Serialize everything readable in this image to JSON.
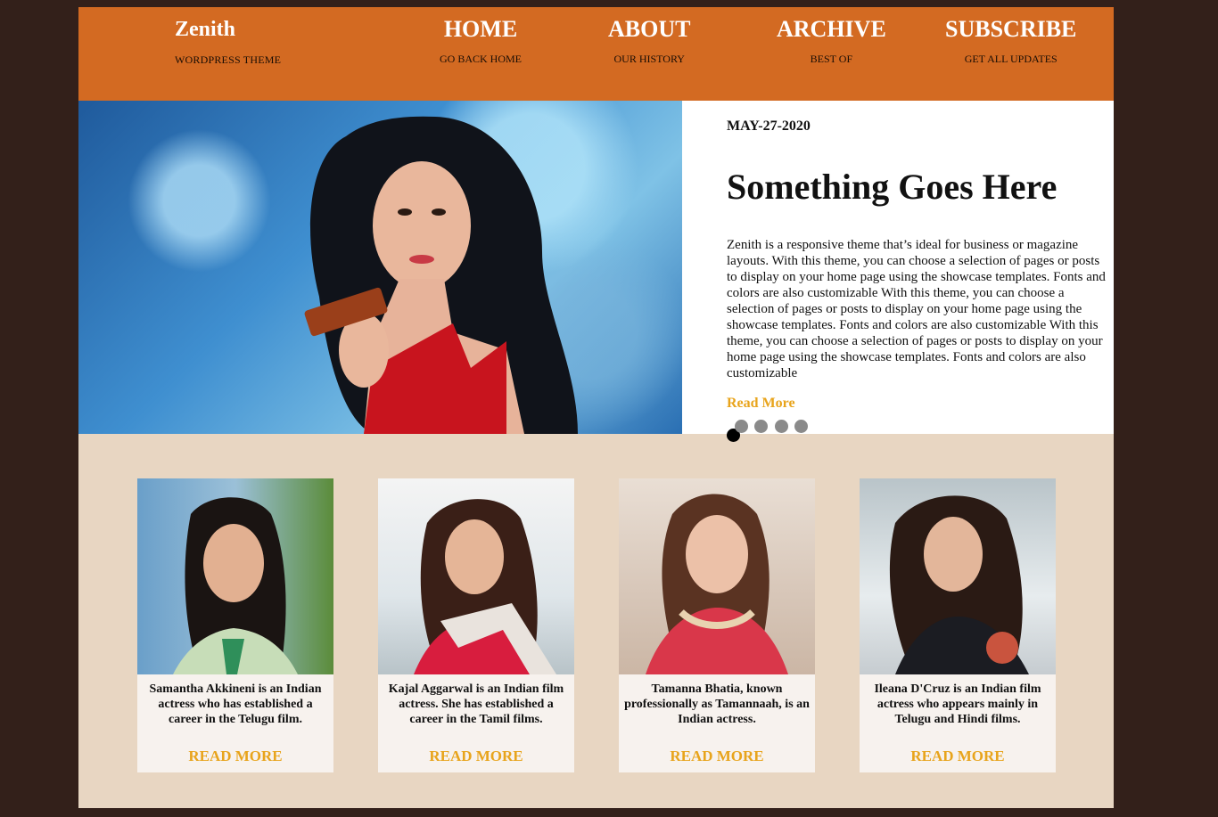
{
  "brand": {
    "name": "Zenith",
    "tagline": "WORDPRESS THEME"
  },
  "nav": [
    {
      "label": "HOME",
      "sub": "GO BACK HOME"
    },
    {
      "label": "ABOUT",
      "sub": "OUR HISTORY"
    },
    {
      "label": "ARCHIVE",
      "sub": "BEST OF"
    },
    {
      "label": "SUBSCRIBE",
      "sub": "GET ALL UPDATES"
    }
  ],
  "hero": {
    "date": "MAY-27-2020",
    "title": "Something Goes Here",
    "body": "Zenith is a responsive theme that’s ideal for business or magazine layouts. With this theme, you can choose a selection of pages or posts to display on your home page using the showcase templates. Fonts and colors are also customizable With this theme, you can choose a selection of pages or posts to display on your home page using the showcase templates. Fonts and colors are also customizable With this theme, you can choose a selection of pages or posts to display on your home page using the showcase templates. Fonts and colors are also customizable",
    "read_more": "Read More",
    "slide_count": 5,
    "active_slide": 1
  },
  "cards": [
    {
      "text": "Samantha Akkineni is an Indian actress who has established a career in the Telugu film.",
      "read_more": "READ MORE"
    },
    {
      "text": "Kajal Aggarwal is an Indian film actress. She has established a career in the Tamil films.",
      "read_more": "READ MORE"
    },
    {
      "text": "Tamanna Bhatia, known professionally as Tamannaah, is an Indian actress.",
      "read_more": "READ MORE"
    },
    {
      "text": "Ileana D'Cruz is an Indian film actress who appears mainly in Telugu and Hindi films.",
      "read_more": "READ MORE"
    }
  ],
  "colors": {
    "background": "#33201a",
    "header": "#d36a22",
    "content_bg": "#e8d6c2",
    "accent": "#e8a41c"
  }
}
